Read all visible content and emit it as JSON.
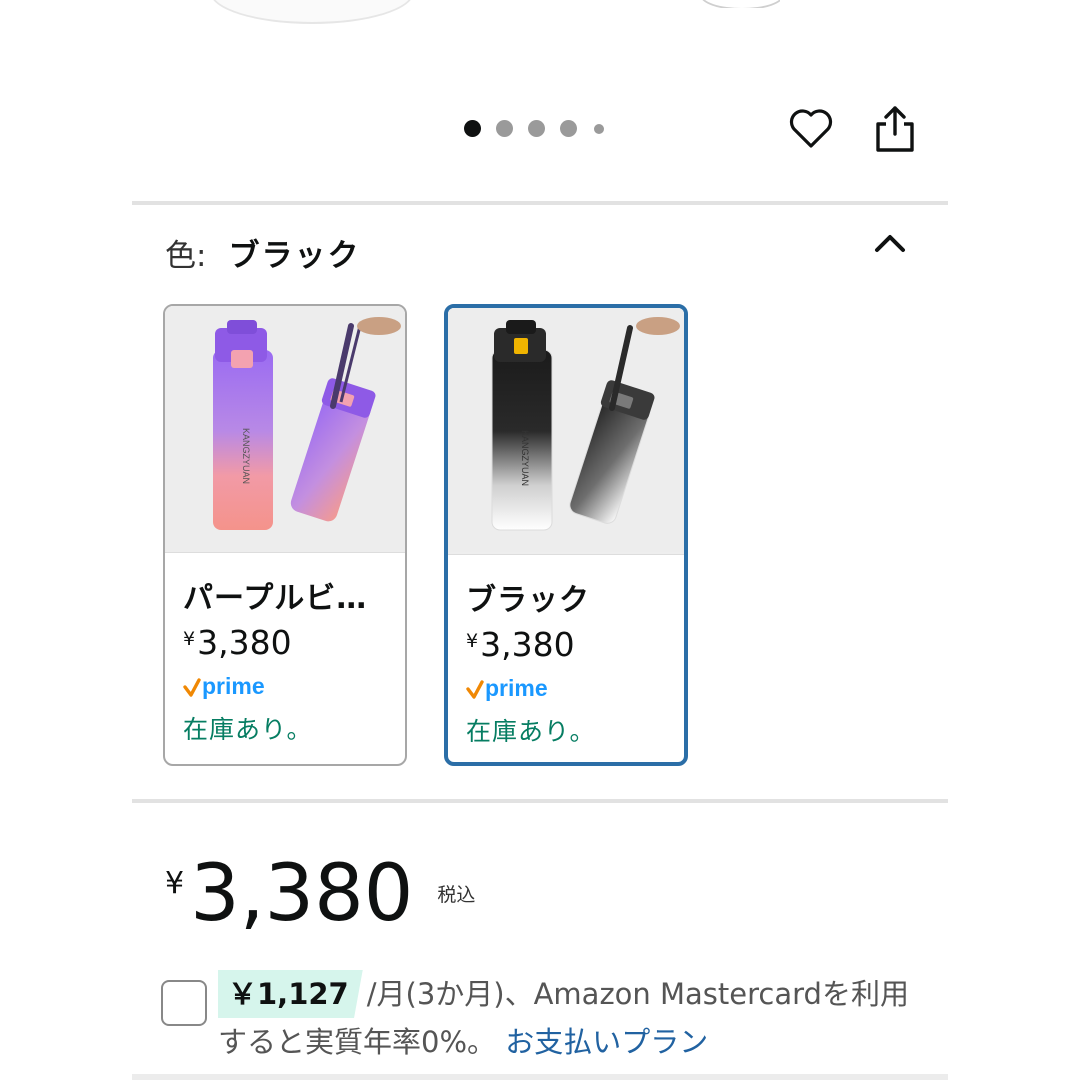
{
  "carousel": {
    "total_dots": 5,
    "active_index": 0
  },
  "color_selector": {
    "label": "色:",
    "selected_value": "ブラック",
    "options": [
      {
        "name": "パープルビ…",
        "currency": "¥",
        "price": "3,380",
        "badge": "prime",
        "stock": "在庫あり。",
        "selected": false
      },
      {
        "name": "ブラック",
        "currency": "¥",
        "price": "3,380",
        "badge": "prime",
        "stock": "在庫あり。",
        "selected": true
      }
    ]
  },
  "product_images": {
    "brand_text": "KANGZYUAN"
  },
  "price": {
    "currency": "¥",
    "amount": "3,380",
    "tax_label": "税込"
  },
  "installment": {
    "monthly_amount": "￥1,127",
    "text_after_badge": "/月(3か月)、Amazon Mastercardを利用すると実質年率0%。",
    "link_text": "お支払いプラン"
  },
  "colors": {
    "accent_blue": "#2b6ea7",
    "stock_green": "#067d62",
    "link_blue": "#2162a1",
    "prime_blue": "#1a98ff",
    "prime_check_orange": "#f08804",
    "badge_green": "#d6f5ec"
  }
}
